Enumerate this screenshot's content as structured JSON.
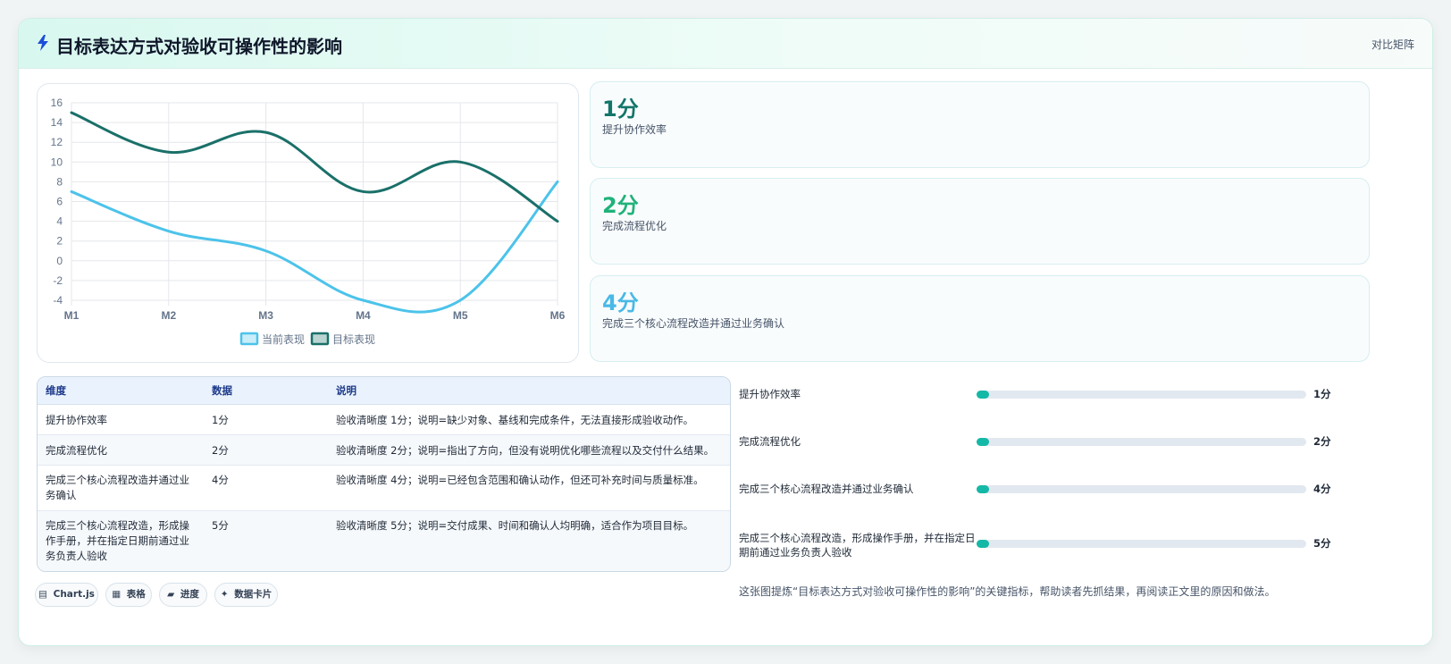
{
  "header": {
    "title": "目标表达方式对验收可操作性的影响",
    "tag": "对比矩阵",
    "icon": "lightning-icon"
  },
  "chart_data": {
    "type": "line",
    "categories": [
      "M1",
      "M2",
      "M3",
      "M4",
      "M5",
      "M6"
    ],
    "series": [
      {
        "name": "当前表现",
        "values": [
          7,
          3,
          1,
          -4,
          -4,
          8
        ],
        "color": "#4cc3ea"
      },
      {
        "name": "目标表现",
        "values": [
          15,
          11,
          13,
          7,
          10,
          4
        ],
        "color": "#1a7069"
      }
    ],
    "ylim": [
      -4,
      16
    ],
    "yticks": [
      "16",
      "14",
      "12",
      "10",
      "8",
      "6",
      "4",
      "2",
      "0",
      "-2",
      "-4"
    ],
    "grid": true,
    "legend": "bottom"
  },
  "kpis": [
    {
      "value": "1分",
      "label": "提升协作效率",
      "color": "#14756a"
    },
    {
      "value": "2分",
      "label": "完成流程优化",
      "color": "#20b27a"
    },
    {
      "value": "4分",
      "label": "完成三个核心流程改造并通过业务确认",
      "color": "#4ab9e6"
    }
  ],
  "table": {
    "headers": [
      "维度",
      "数据",
      "说明"
    ],
    "rows": [
      [
        "提升协作效率",
        "1分",
        "验收清晰度 1分；说明=缺少对象、基线和完成条件，无法直接形成验收动作。"
      ],
      [
        "完成流程优化",
        "2分",
        "验收清晰度 2分；说明=指出了方向，但没有说明优化哪些流程以及交付什么结果。"
      ],
      [
        "完成三个核心流程改造并通过业务确认",
        "4分",
        "验收清晰度 4分；说明=已经包含范围和确认动作，但还可补充时间与质量标准。"
      ],
      [
        "完成三个核心流程改造，形成操作手册，并在指定日期前通过业务负责人验收",
        "5分",
        "验收清晰度 5分；说明=交付成果、时间和确认人均明确，适合作为项目目标。"
      ]
    ]
  },
  "progress": [
    {
      "label": "提升协作效率",
      "value": "1分",
      "fraction": 0.0
    },
    {
      "label": "完成流程优化",
      "value": "2分",
      "fraction": 0.0
    },
    {
      "label": "完成三个核心流程改造并通过业务确认",
      "value": "4分",
      "fraction": 0.0
    },
    {
      "label": "完成三个核心流程改造，形成操作手册，并在指定日期前通过业务负责人验收",
      "value": "5分",
      "fraction": 0.0
    }
  ],
  "chips": [
    {
      "icon": "chart-icon",
      "glyph": "▤",
      "label": "Chart.js"
    },
    {
      "icon": "table-icon",
      "glyph": "▦",
      "label": "表格"
    },
    {
      "icon": "progress-icon",
      "glyph": "▰",
      "label": "进度"
    },
    {
      "icon": "sparkle-icon",
      "glyph": "✦",
      "label": "数据卡片"
    }
  ],
  "note": "这张图提炼“目标表达方式对验收可操作性的影响”的关键指标，帮助读者先抓结果，再阅读正文里的原因和做法。"
}
